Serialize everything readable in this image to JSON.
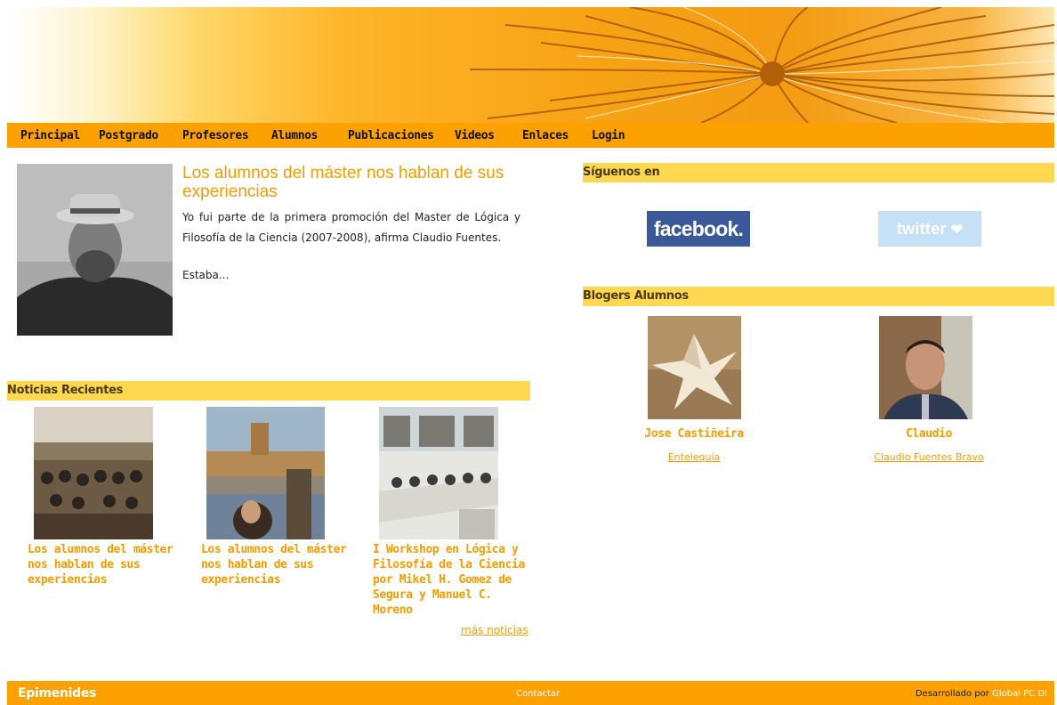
{
  "nav": {
    "items": [
      {
        "label": "Principal"
      },
      {
        "label": "Postgrado"
      },
      {
        "label": "Profesores"
      },
      {
        "label": "Alumnos"
      },
      {
        "label": "Publicaciones"
      },
      {
        "label": "Videos"
      },
      {
        "label": "Enlaces"
      },
      {
        "label": "Login"
      }
    ]
  },
  "featured": {
    "title": "Los alumnos del máster nos hablan de sus experiencias",
    "text": "Yo fui parte de la primera promoción del Master de Lógica y Filosofía de la Ciencia (2007-2008), afirma Claudio Fuentes.",
    "text2": "Estaba..."
  },
  "news": {
    "heading": "Noticias Recientes",
    "items": [
      {
        "title": "Los alumnos del máster nos hablan de sus experiencias"
      },
      {
        "title": "Los alumnos del máster nos hablan de sus experiencias"
      },
      {
        "title": "I Workshop en Lógica y Filosofía de la Ciencia por Mikel H. Gomez de Segura y Manuel C. Moreno"
      }
    ],
    "more_label": "más noticias"
  },
  "social": {
    "heading": "Síguenos en",
    "facebook_label": "facebook.",
    "twitter_label": "twitter"
  },
  "bloggers": {
    "heading": "Blogers Alumnos",
    "items": [
      {
        "name": "Jose Castiñeira",
        "link": "Entelequia"
      },
      {
        "name": "Claudio",
        "link": "Claudio Fuentes Bravo"
      }
    ]
  },
  "footer": {
    "brand": "Epimenides",
    "contact": "Contactar",
    "dev_prefix": "Desarrollado por",
    "dev_link": "Global PC DI"
  },
  "colors": {
    "nav_bg": "#fca100",
    "section_bg": "#fed850",
    "accent": "#f59d00"
  }
}
